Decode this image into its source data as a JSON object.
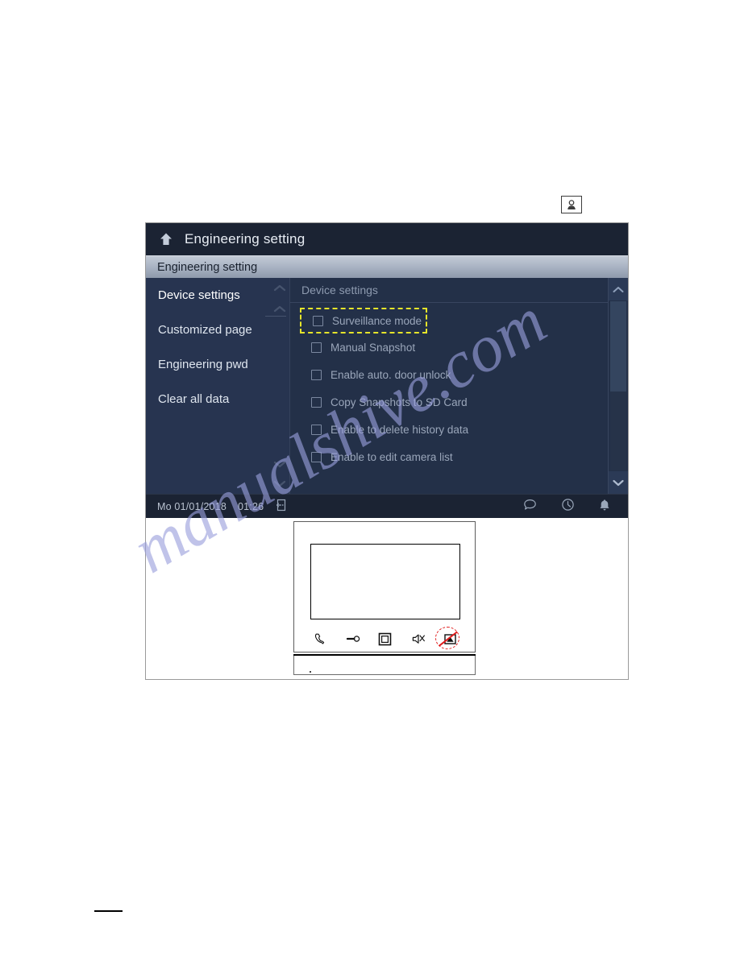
{
  "window": {
    "title": "Engineering setting",
    "back_icon": "up-arrow-icon"
  },
  "breadcrumb": {
    "label": "Engineering setting"
  },
  "sidebar": {
    "items": [
      {
        "label": "Device settings",
        "selected": true
      },
      {
        "label": "Customized page",
        "selected": false
      },
      {
        "label": "Engineering pwd",
        "selected": false
      },
      {
        "label": "Clear all data",
        "selected": false
      }
    ],
    "scroll_up_icon": "chevron-up-icon",
    "scroll_down_icon": "chevron-down-icon"
  },
  "content": {
    "header": "Device settings",
    "options": [
      {
        "label": "Surveillance mode",
        "checked": false,
        "highlighted": true
      },
      {
        "label": "Manual Snapshot",
        "checked": false,
        "highlighted": false
      },
      {
        "label": "Enable auto. door unlock",
        "checked": false,
        "highlighted": false
      },
      {
        "label": "Copy Snapshots to SD Card",
        "checked": false,
        "highlighted": false
      },
      {
        "label": "Enable to delete history data",
        "checked": false,
        "highlighted": false
      },
      {
        "label": "Enable to edit camera list",
        "checked": false,
        "highlighted": false
      }
    ],
    "scrollbar": {
      "up_icon": "chevron-up-icon",
      "down_icon": "chevron-down-icon"
    }
  },
  "status_bar": {
    "date": "Mo 01/01/2018",
    "time": "01:26",
    "left_icon": "door-unlock-icon",
    "right_icons": [
      "message-bubble-icon",
      "clock-icon",
      "bell-icon"
    ]
  },
  "diagram": {
    "monitor_icons": [
      "phone-handset-icon",
      "key-icon",
      "monitor-square-icon",
      "mute-speaker-icon",
      "surveillance-icon"
    ],
    "marker": {
      "shape": "dashed-circle-with-slash",
      "color": "#e01b1b",
      "target_icon": "surveillance-icon"
    }
  },
  "page_icons": {
    "contact": "contact-person-icon"
  },
  "watermark": {
    "text": "manualshive.com",
    "color": "#9aa0dd"
  },
  "colors": {
    "title_bar": "#1b2333",
    "panel": "#233048",
    "sidebar": "#273450",
    "highlight_border": "#e6e52a",
    "marker_red": "#e01b1b",
    "text_light": "#e9eef5",
    "text_muted": "#9aa6ba"
  }
}
